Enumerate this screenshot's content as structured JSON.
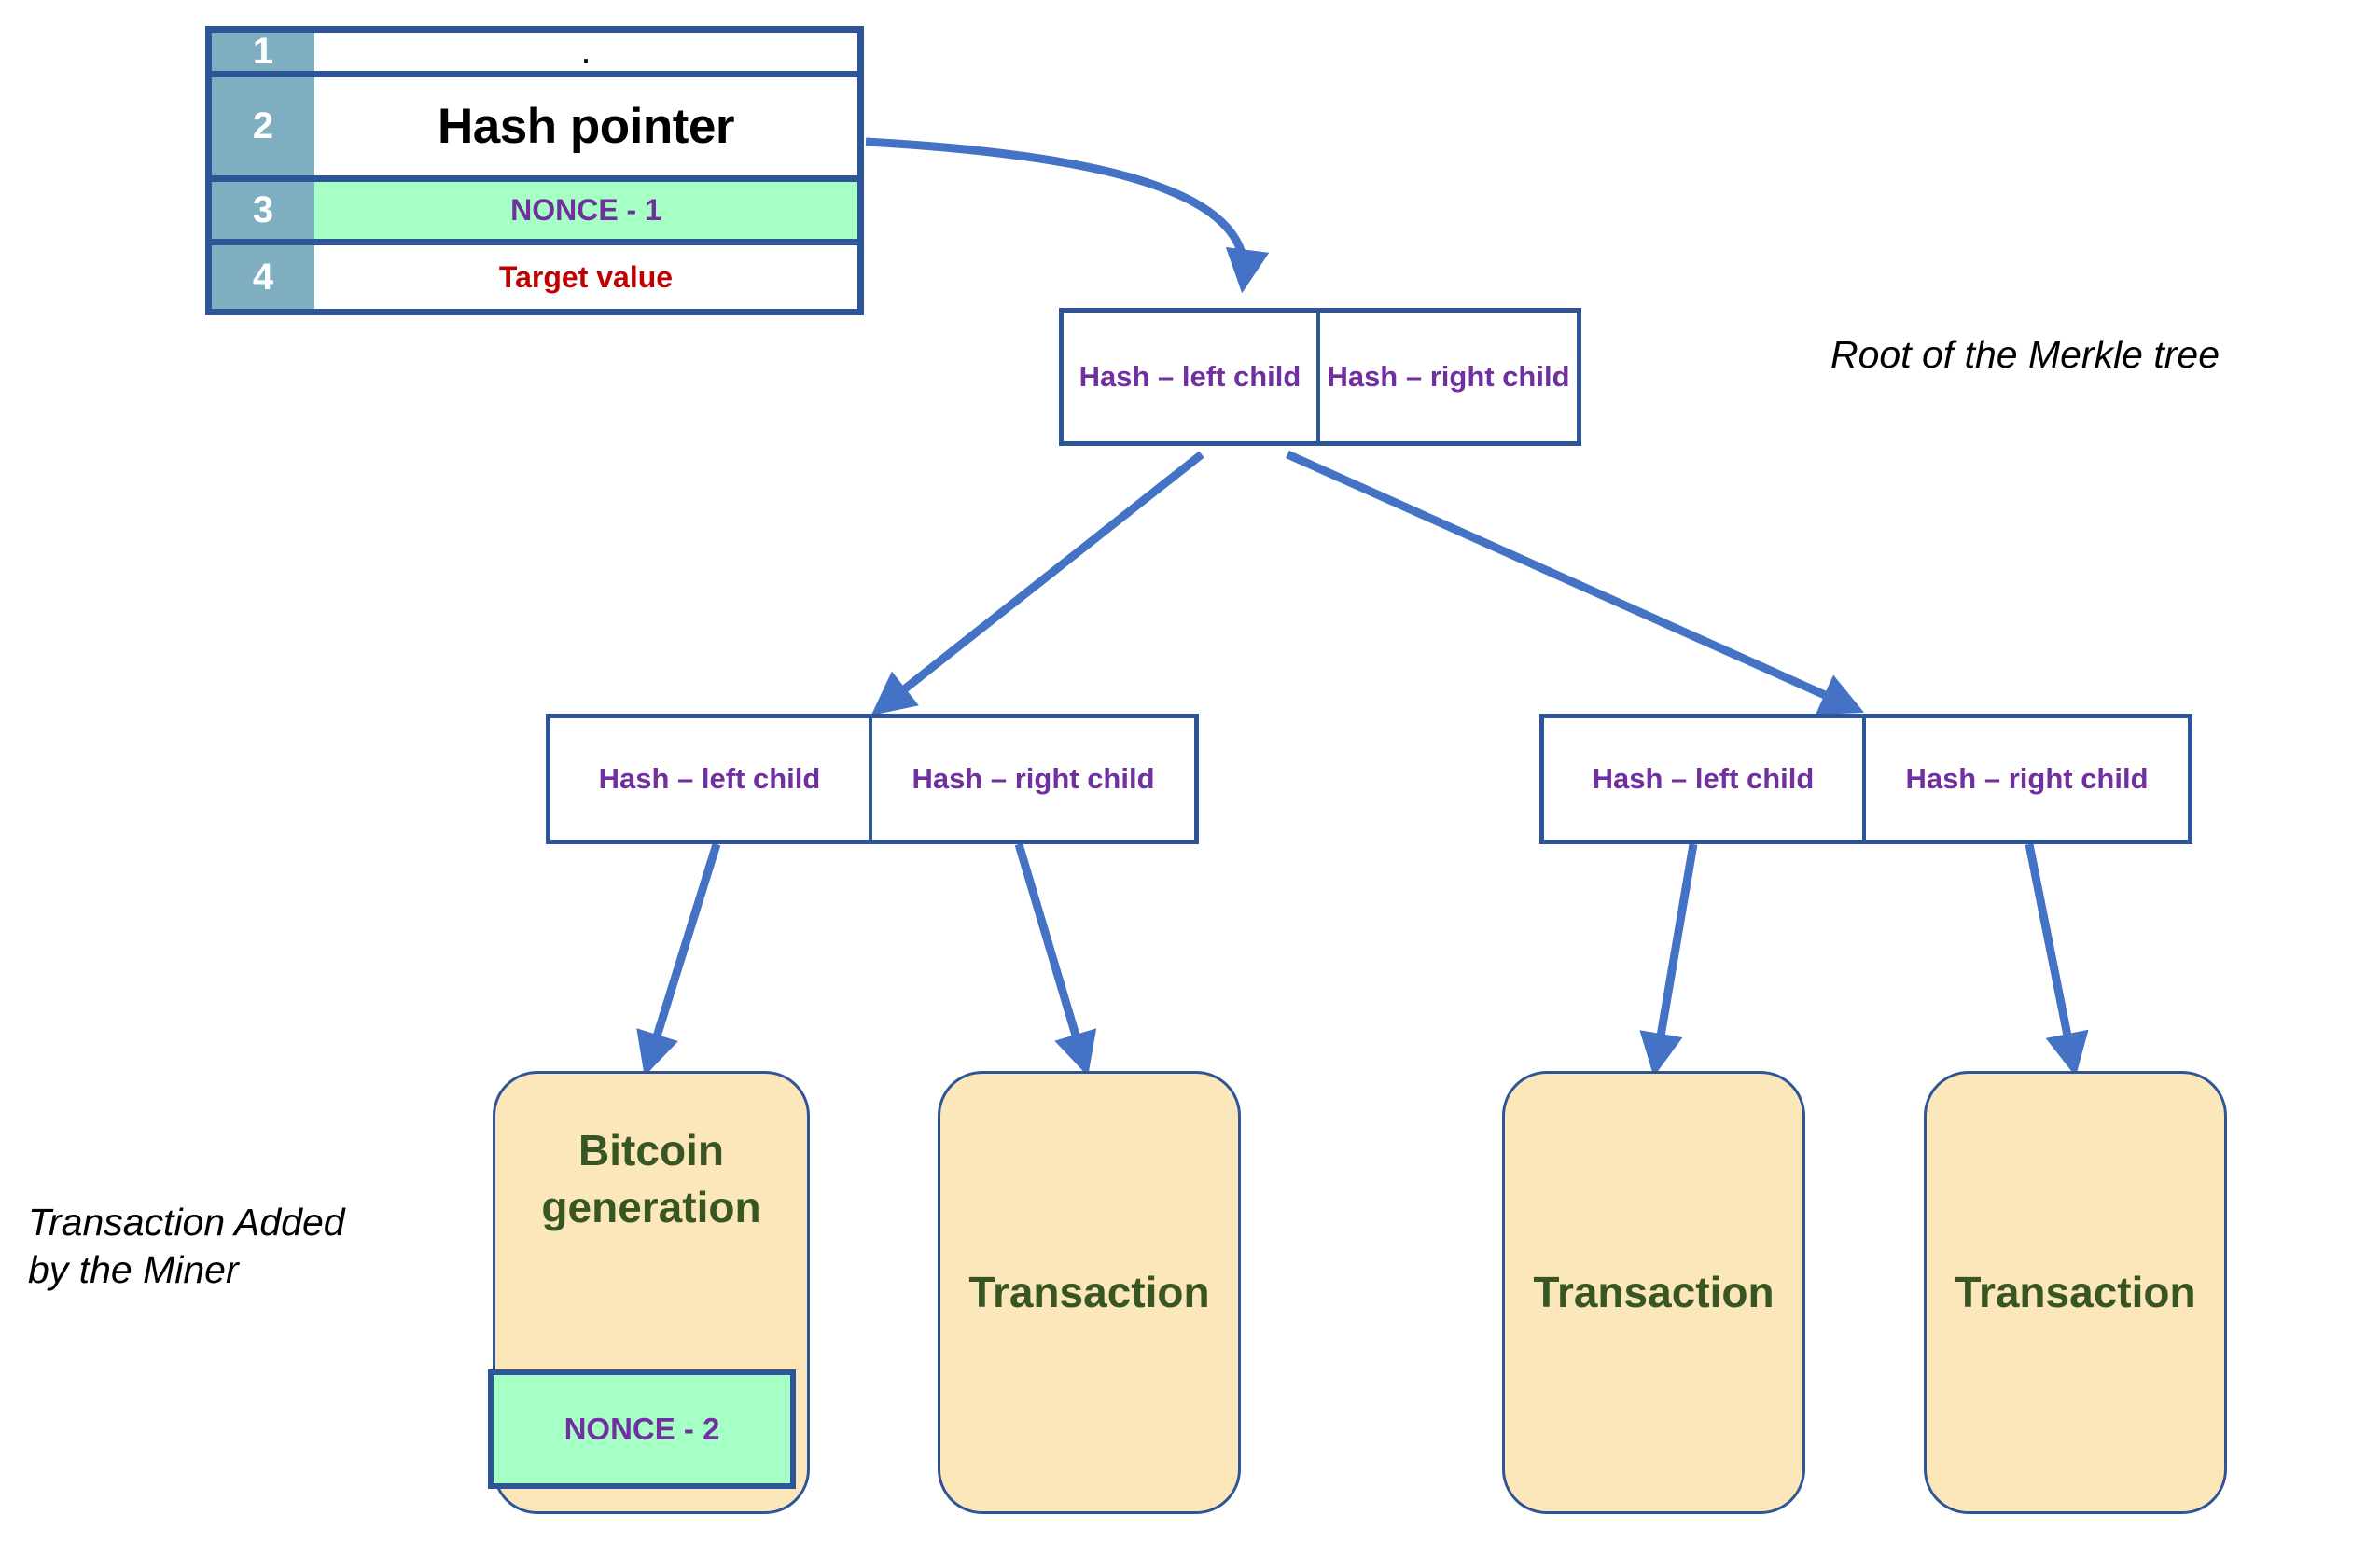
{
  "diagram": {
    "title": "Bitcoin block header and Merkle tree structure",
    "colors": {
      "border_navy": "#2E5597",
      "arrow_blue": "#4472C4",
      "row_number_fill": "#7FAEC1",
      "nonce_green": "#A6FFC4",
      "transaction_beige": "#FBE7BA",
      "hash_purple": "#7030A0",
      "target_red": "#C00000",
      "transaction_green_text": "#375623"
    }
  },
  "block_header": {
    "rows": [
      {
        "number": "1",
        "label": ".",
        "style": "plain"
      },
      {
        "number": "2",
        "label": "Hash pointer",
        "style": "hash-pointer"
      },
      {
        "number": "3",
        "label": "NONCE - 1",
        "style": "nonce"
      },
      {
        "number": "4",
        "label": "Target value",
        "style": "target"
      }
    ]
  },
  "merkle": {
    "root": {
      "left_label": "Hash – left child",
      "right_label": "Hash – right child"
    },
    "level2": [
      {
        "left_label": "Hash – left child",
        "right_label": "Hash – right child"
      },
      {
        "left_label": "Hash – left child",
        "right_label": "Hash – right child"
      }
    ],
    "leaves": [
      {
        "label": "Bitcoin generation",
        "nonce": "NONCE - 2"
      },
      {
        "label": "Transaction",
        "nonce": null
      },
      {
        "label": "Transaction",
        "nonce": null
      },
      {
        "label": "Transaction",
        "nonce": null
      }
    ]
  },
  "annotations": {
    "root_note": "Root of the Merkle tree",
    "miner_note": "Transaction Added\nby the Miner"
  }
}
